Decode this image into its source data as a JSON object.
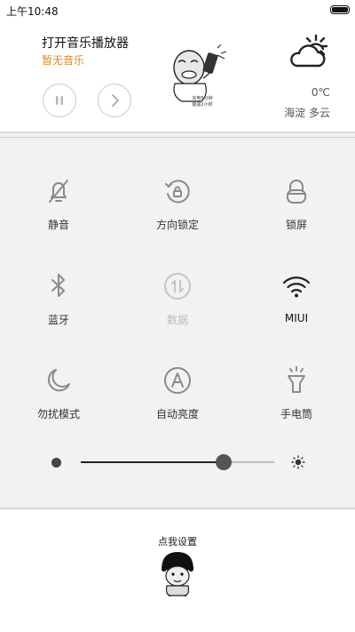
{
  "status": {
    "time": "上午10:48",
    "battery_icon": "battery-full-icon"
  },
  "player": {
    "title": "打开音乐播放器",
    "subtitle": "暂无音乐",
    "pause_icon": "pause-icon",
    "next_icon": "chevron-right-icon",
    "meme_caption_1": "充电5分钟",
    "meme_caption_2": "装逼2小时",
    "subtitle_color": "#e28a2b"
  },
  "weather": {
    "icon": "partly-cloudy-icon",
    "temperature": "0℃",
    "location": "海淀  多云"
  },
  "tiles": [
    {
      "label": "静音",
      "icon": "bell-off-icon",
      "active": false
    },
    {
      "label": "方向锁定",
      "icon": "rotation-lock-icon",
      "active": false
    },
    {
      "label": "锁屏",
      "icon": "lock-icon",
      "active": false
    },
    {
      "label": "蓝牙",
      "icon": "bluetooth-icon",
      "active": false
    },
    {
      "label": "数据",
      "icon": "mobile-data-icon",
      "active": false,
      "disabled": true
    },
    {
      "label": "MIUI",
      "icon": "wifi-icon",
      "active": true
    },
    {
      "label": "勿扰模式",
      "icon": "moon-icon",
      "active": false
    },
    {
      "label": "自动亮度",
      "icon": "auto-brightness-icon",
      "active": false
    },
    {
      "label": "手电筒",
      "icon": "flashlight-icon",
      "active": false
    }
  ],
  "brightness": {
    "level": 0.74,
    "low_icon": "brightness-low-icon",
    "high_icon": "sun-icon"
  },
  "settings": {
    "label": "点我设置",
    "icon": "mushroom-head-character"
  }
}
